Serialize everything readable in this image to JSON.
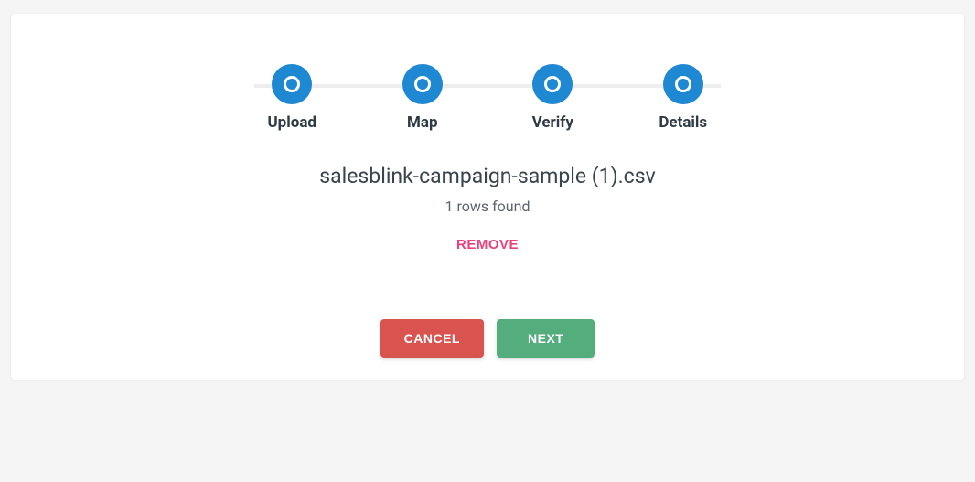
{
  "stepper": {
    "steps": [
      {
        "label": "Upload"
      },
      {
        "label": "Map"
      },
      {
        "label": "Verify"
      },
      {
        "label": "Details"
      }
    ]
  },
  "file": {
    "name": "salesblink-campaign-sample (1).csv",
    "rows_found": "1 rows found",
    "remove_label": "REMOVE"
  },
  "actions": {
    "cancel_label": "CANCEL",
    "next_label": "NEXT"
  }
}
